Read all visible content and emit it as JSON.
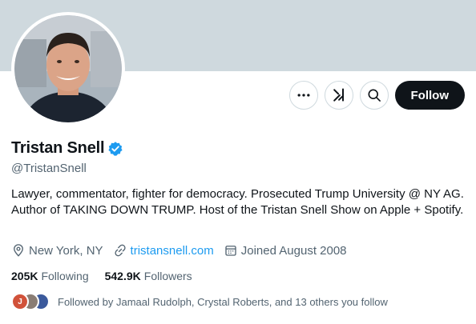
{
  "profile": {
    "display_name": "Tristan Snell",
    "handle": "@TristanSnell",
    "bio": "Lawyer, commentator, fighter for democracy. Prosecuted Trump University @ NY AG. Author of TAKING DOWN TRUMP. Host of the Tristan Snell Show on Apple + Spotify.",
    "verified_icon": "verified-badge-icon"
  },
  "actions": {
    "more_icon": "more-icon",
    "grok_icon": "grok-icon",
    "search_icon": "search-icon",
    "follow_label": "Follow"
  },
  "meta": {
    "location": "New York, NY",
    "website": "tristansnell.com",
    "joined": "Joined August 2008"
  },
  "stats": {
    "following_count": "205K",
    "following_label": "Following",
    "followers_count": "542.9K",
    "followers_label": "Followers"
  },
  "followed_by": {
    "text": "Followed by Jamaal Rudolph, Crystal Roberts, and 13 others you follow",
    "first_initial": "J"
  },
  "colors": {
    "banner": "#cfd9de",
    "accent": "#1d9bf0",
    "text_primary": "#0f1419",
    "text_secondary": "#536471",
    "follow_bg": "#0f1419"
  }
}
